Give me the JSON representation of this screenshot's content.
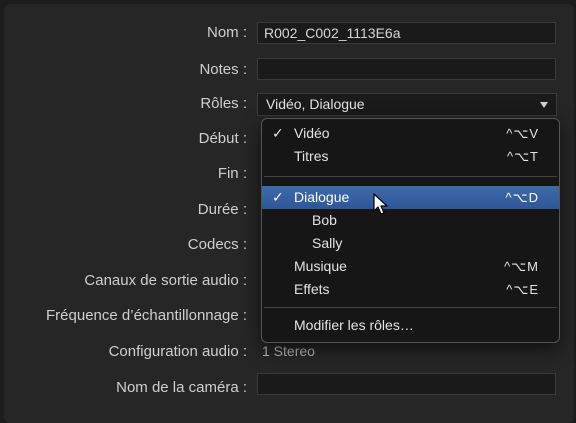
{
  "labels": {
    "nom": "Nom :",
    "notes": "Notes :",
    "roles": "Rôles :",
    "debut": "Début :",
    "fin": "Fin :",
    "duree": "Durée :",
    "codecs": "Codecs :",
    "canaux": "Canaux de sortie audio :",
    "frequence": "Fréquence d’échantillonnage :",
    "config": "Configuration audio :",
    "camera": "Nom de la caméra :"
  },
  "fields": {
    "nom_value": "R002_C002_1113E6a",
    "notes_value": "",
    "roles_selected": "Vidéo, Dialogue",
    "config_value": "1 Stereo",
    "camera_value": ""
  },
  "menu": {
    "items": [
      {
        "label": "Vidéo",
        "checked": true,
        "shortcut": "^⌥V"
      },
      {
        "label": "Titres",
        "checked": false,
        "shortcut": "^⌥T"
      },
      {
        "label": "Dialogue",
        "checked": true,
        "shortcut": "^⌥D",
        "highlighted": true
      },
      {
        "label": "Bob",
        "checked": false,
        "shortcut": ""
      },
      {
        "label": "Sally",
        "checked": false,
        "shortcut": ""
      },
      {
        "label": "Musique",
        "checked": false,
        "shortcut": "^⌥M"
      },
      {
        "label": "Effets",
        "checked": false,
        "shortcut": "^⌥E"
      },
      {
        "label": "Modifier les rôles…",
        "checked": false,
        "shortcut": ""
      }
    ],
    "check_glyph": "✓"
  },
  "colors": {
    "highlight": "#3a66a6",
    "background": "#262626"
  },
  "icons": {
    "dropdown": "chevron-down-icon",
    "cursor": "mouse-pointer-icon"
  }
}
